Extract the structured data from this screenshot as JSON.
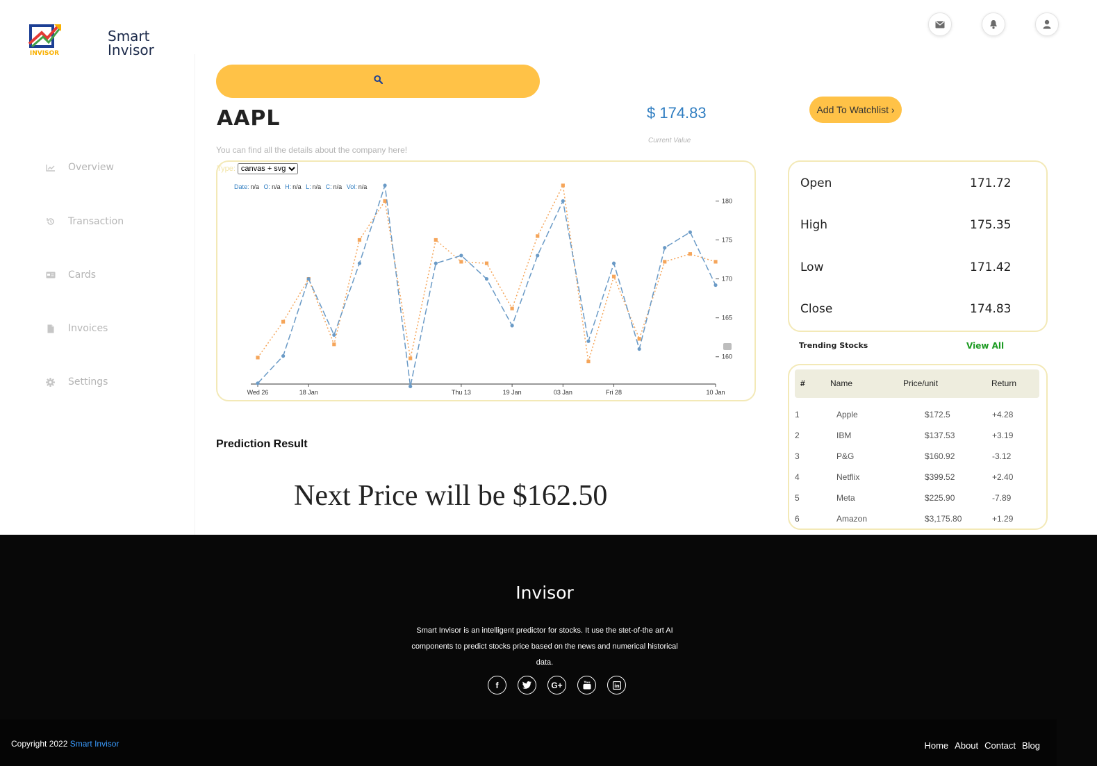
{
  "brand": {
    "name_line1": "Smart",
    "name_line2": "Invisor"
  },
  "header_icons": [
    "mail-icon",
    "bell-icon",
    "user-icon"
  ],
  "sidebar": {
    "items": [
      {
        "label": "Overview",
        "icon": "chart-line-icon"
      },
      {
        "label": "Transaction",
        "icon": "history-icon"
      },
      {
        "label": "Cards",
        "icon": "card-icon"
      },
      {
        "label": "Invoices",
        "icon": "file-icon"
      },
      {
        "label": "Settings",
        "icon": "gear-icon"
      }
    ]
  },
  "search": {
    "icon": "search-icon"
  },
  "stock": {
    "ticker": "AAPL",
    "tagline": "You can find all the details about the company here!",
    "price": "$ 174.83",
    "price_caption": "Current Value",
    "watchlist_button": "Add To Watchlist ›"
  },
  "chart_controls": {
    "type_label": "Type:",
    "type_value": "canvas + svg",
    "legend": {
      "date_key": "Date:",
      "date_val": "n/a",
      "o_key": "O:",
      "o_val": "n/a",
      "h_key": "H:",
      "h_val": "n/a",
      "l_key": "L:",
      "l_val": "n/a",
      "c_key": "C:",
      "c_val": "n/a",
      "vol_key": "Vol:",
      "vol_val": "n/a"
    }
  },
  "chart_data": {
    "type": "line",
    "x_tick_labels": [
      "Wed 26",
      "18 Jan",
      "Thu 13",
      "19 Jan",
      "03 Jan",
      "Fri 28",
      "10 Jan"
    ],
    "y_ticks": [
      160,
      165,
      170,
      175,
      180
    ],
    "ylim": [
      156.5,
      182
    ],
    "series": [
      {
        "values": [
          156.6,
          160.1,
          170,
          162.8,
          172,
          182,
          156.2,
          172,
          173,
          170,
          164,
          173,
          180,
          162,
          172,
          161,
          174,
          176,
          169.2
        ]
      },
      {
        "values": [
          159.9,
          164.5,
          170,
          161.6,
          175,
          180,
          159.8,
          175,
          172.2,
          172,
          166.2,
          175.5,
          182,
          159.4,
          170.3,
          162.3,
          172.2,
          173.2,
          172.2
        ]
      }
    ],
    "colors": {
      "series_1": "#6a9ac6",
      "series_2": "#f5a55a"
    }
  },
  "prediction": {
    "title": "Prediction Result",
    "text": "Next Price will be $162.50"
  },
  "ohlc": [
    {
      "label": "Open",
      "value": "171.72"
    },
    {
      "label": "High",
      "value": "175.35"
    },
    {
      "label": "Low",
      "value": "171.42"
    },
    {
      "label": "Close",
      "value": "174.83"
    }
  ],
  "trending": {
    "title": "Trending Stocks",
    "view_all": "View All",
    "headers": [
      "#",
      "Name",
      "Price/unit",
      "Return"
    ],
    "rows": [
      {
        "n": "1",
        "name": "Apple",
        "price": "$172.5",
        "ret": "+4.28"
      },
      {
        "n": "2",
        "name": "IBM",
        "price": "$137.53",
        "ret": "+3.19"
      },
      {
        "n": "3",
        "name": "P&G",
        "price": "$160.92",
        "ret": "-3.12"
      },
      {
        "n": "4",
        "name": "Netflix",
        "price": "$399.52",
        "ret": "+2.40"
      },
      {
        "n": "5",
        "name": "Meta",
        "price": "$225.90",
        "ret": "-7.89"
      },
      {
        "n": "6",
        "name": "Amazon",
        "price": "$3,175.80",
        "ret": "+1.29"
      }
    ]
  },
  "footer": {
    "title": "Invisor",
    "desc_l1": "Smart Invisor is an intelligent predictor for stocks. It use the stet-of-the art AI",
    "desc_l2": "components to predict stocks price based on the news and numerical historical",
    "desc_l3": "data.",
    "socials": [
      "f",
      "t",
      "G+",
      "yt",
      "in"
    ],
    "copyright_prefix": "Copyright  2022",
    "copyright_brand": "Smart Invisor",
    "links": [
      "Home",
      "About",
      "Contact",
      "Blog"
    ]
  }
}
